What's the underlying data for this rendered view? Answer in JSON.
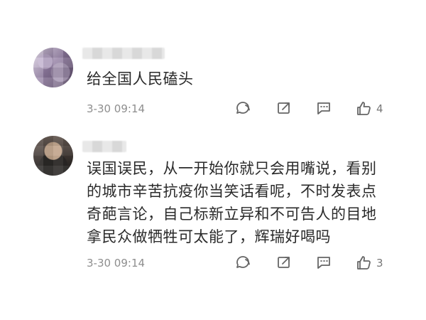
{
  "comments": [
    {
      "text": "给全国人民磕头",
      "timestamp": "3-30 09:14",
      "like_count": "4"
    },
    {
      "text": "误国误民，从一开始你就只会用嘴说，看别\n的城市辛苦抗疫你当笑话看呢，不时发表点\n奇葩言论，自己标新立异和不可告人的目地\n拿民众做牺牲可太能了，辉瑞好喝吗",
      "timestamp": "3-30 09:14",
      "like_count": "3"
    }
  ],
  "icons": {
    "reply": "reply-icon",
    "share": "share-icon",
    "comment": "comment-icon",
    "like": "thumbs-up-icon"
  },
  "colors": {
    "text": "#2a2a2a",
    "meta": "#8e8e8e",
    "icon": "#666666",
    "background": "#ffffff"
  }
}
